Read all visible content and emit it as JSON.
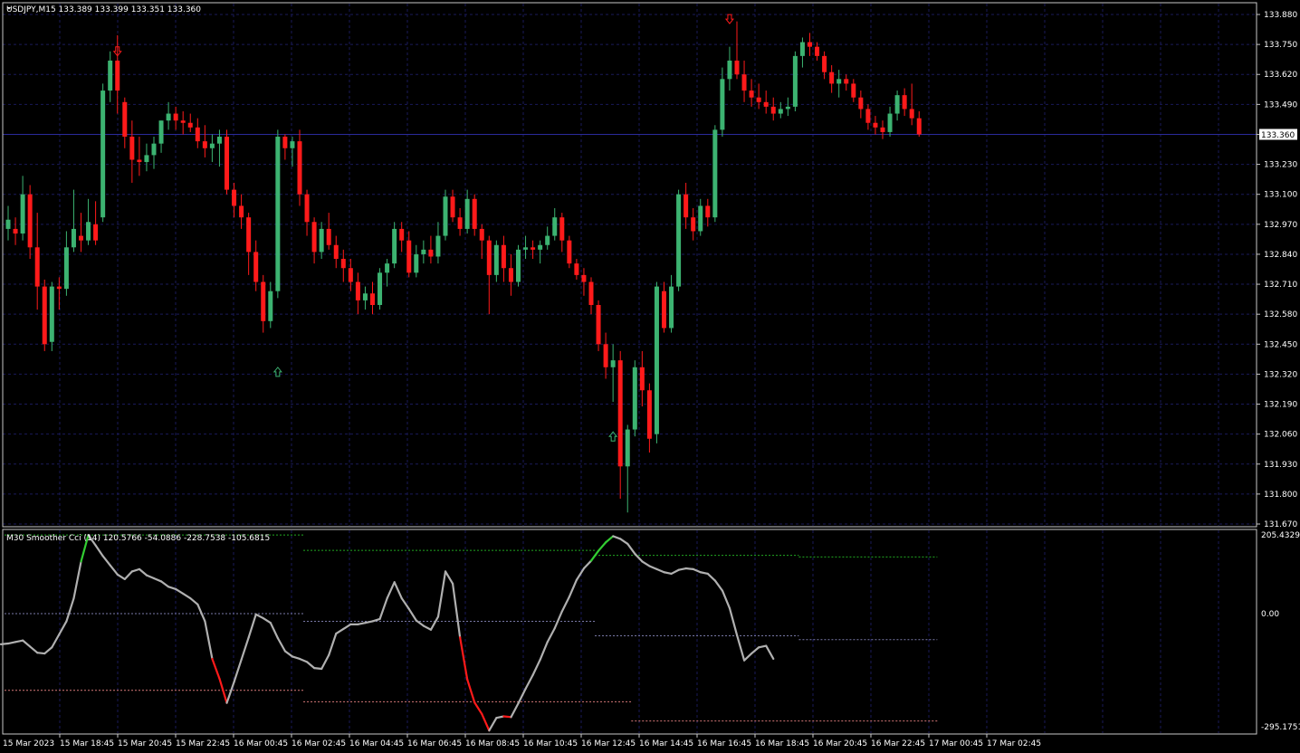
{
  "window": {
    "symbol_header": "USDJPY,M15  133.389 133.399 133.351 133.360"
  },
  "price_axis": {
    "ticks": [
      "133.880",
      "133.750",
      "133.620",
      "133.490",
      "133.360",
      "133.230",
      "133.100",
      "132.970",
      "132.840",
      "132.710",
      "132.580",
      "132.450",
      "132.320",
      "132.190",
      "132.060",
      "131.930",
      "131.800",
      "131.670"
    ],
    "current_price": "133.360"
  },
  "indicator": {
    "header": "M30 Smoother Cci (14) 120.5766 -54.0886 -228.7538 -105.6815",
    "ticks": [
      "205.4329",
      "0.00",
      "-295.1751"
    ]
  },
  "time_axis": {
    "labels": [
      "15 Mar 2023",
      "15 Mar 18:45",
      "15 Mar 20:45",
      "15 Mar 22:45",
      "16 Mar 00:45",
      "16 Mar 02:45",
      "16 Mar 04:45",
      "16 Mar 06:45",
      "16 Mar 08:45",
      "16 Mar 10:45",
      "16 Mar 12:45",
      "16 Mar 14:45",
      "16 Mar 16:45",
      "16 Mar 18:45",
      "16 Mar 20:45",
      "16 Mar 22:45",
      "17 Mar 00:45",
      "17 Mar 02:45"
    ]
  },
  "colors": {
    "bull": "#3cb371",
    "bear": "#ff1a1a",
    "grid": "#1a1a5a",
    "cci": "#b0b0b0",
    "cci_up": "#32cd32",
    "cci_down": "#ff1a1a"
  },
  "chart_data": [
    {
      "type": "candlestick",
      "title": "USDJPY,M15",
      "ylim": [
        131.67,
        133.88
      ],
      "candles": [
        [
          132.95,
          133.05,
          132.9,
          132.99
        ],
        [
          132.95,
          133.0,
          132.88,
          132.93
        ],
        [
          132.93,
          133.18,
          132.9,
          133.1
        ],
        [
          133.1,
          133.14,
          132.82,
          132.87
        ],
        [
          132.87,
          133.02,
          132.6,
          132.7
        ],
        [
          132.7,
          132.73,
          132.42,
          132.45
        ],
        [
          132.46,
          132.72,
          132.42,
          132.7
        ],
        [
          132.7,
          132.74,
          132.6,
          132.69
        ],
        [
          132.69,
          132.94,
          132.66,
          132.87
        ],
        [
          132.87,
          133.12,
          132.85,
          132.95
        ],
        [
          132.92,
          133.02,
          132.85,
          132.9
        ],
        [
          132.9,
          133.08,
          132.88,
          132.98
        ],
        [
          132.97,
          133.07,
          132.88,
          132.9
        ],
        [
          133.0,
          133.58,
          132.98,
          133.55
        ],
        [
          133.55,
          133.72,
          133.5,
          133.68
        ],
        [
          133.68,
          133.79,
          133.45,
          133.55
        ],
        [
          133.5,
          133.52,
          133.3,
          133.35
        ],
        [
          133.35,
          133.42,
          133.15,
          133.25
        ],
        [
          133.25,
          133.35,
          133.18,
          133.24
        ],
        [
          133.24,
          133.32,
          133.2,
          133.27
        ],
        [
          133.27,
          133.35,
          133.21,
          133.32
        ],
        [
          133.32,
          133.42,
          133.28,
          133.42
        ],
        [
          133.42,
          133.5,
          133.38,
          133.45
        ],
        [
          133.45,
          133.48,
          133.38,
          133.42
        ],
        [
          133.42,
          133.46,
          133.36,
          133.41
        ],
        [
          133.41,
          133.45,
          133.37,
          133.39
        ],
        [
          133.39,
          133.43,
          133.3,
          133.33
        ],
        [
          133.33,
          133.4,
          133.26,
          133.3
        ],
        [
          133.3,
          133.36,
          133.24,
          133.32
        ],
        [
          133.32,
          133.38,
          133.22,
          133.35
        ],
        [
          133.35,
          133.38,
          133.1,
          133.12
        ],
        [
          133.12,
          133.15,
          133.0,
          133.05
        ],
        [
          133.05,
          133.1,
          132.95,
          133.0
        ],
        [
          133.0,
          133.02,
          132.75,
          132.85
        ],
        [
          132.85,
          132.9,
          132.68,
          132.72
        ],
        [
          132.72,
          132.75,
          132.5,
          132.55
        ],
        [
          132.55,
          132.72,
          132.52,
          132.68
        ],
        [
          132.68,
          133.38,
          132.65,
          133.35
        ],
        [
          133.35,
          133.36,
          133.25,
          133.3
        ],
        [
          133.3,
          133.35,
          133.22,
          133.33
        ],
        [
          133.33,
          133.38,
          133.05,
          133.1
        ],
        [
          133.1,
          133.12,
          132.92,
          132.98
        ],
        [
          132.98,
          133.0,
          132.8,
          132.85
        ],
        [
          132.85,
          132.98,
          132.82,
          132.95
        ],
        [
          132.95,
          133.02,
          132.86,
          132.88
        ],
        [
          132.88,
          132.92,
          132.78,
          132.82
        ],
        [
          132.82,
          132.86,
          132.72,
          132.78
        ],
        [
          132.78,
          132.82,
          132.68,
          132.72
        ],
        [
          132.72,
          132.76,
          132.58,
          132.64
        ],
        [
          132.64,
          132.7,
          132.6,
          132.67
        ],
        [
          132.67,
          132.72,
          132.58,
          132.62
        ],
        [
          132.62,
          132.78,
          132.6,
          132.76
        ],
        [
          132.76,
          132.82,
          132.7,
          132.8
        ],
        [
          132.8,
          132.98,
          132.78,
          132.95
        ],
        [
          132.95,
          132.98,
          132.85,
          132.9
        ],
        [
          132.9,
          132.94,
          132.74,
          132.76
        ],
        [
          132.76,
          132.88,
          132.74,
          132.84
        ],
        [
          132.84,
          132.9,
          132.8,
          132.86
        ],
        [
          132.86,
          132.92,
          132.8,
          132.83
        ],
        [
          132.83,
          132.98,
          132.8,
          132.92
        ],
        [
          132.92,
          133.12,
          132.9,
          133.09
        ],
        [
          133.09,
          133.12,
          132.98,
          133.0
        ],
        [
          133.0,
          133.04,
          132.92,
          132.95
        ],
        [
          132.95,
          133.12,
          132.93,
          133.08
        ],
        [
          133.08,
          133.1,
          132.92,
          132.95
        ],
        [
          132.95,
          132.97,
          132.82,
          132.9
        ],
        [
          132.9,
          132.92,
          132.58,
          132.75
        ],
        [
          132.75,
          132.9,
          132.72,
          132.88
        ],
        [
          132.88,
          132.92,
          132.72,
          132.78
        ],
        [
          132.78,
          132.84,
          132.66,
          132.72
        ],
        [
          132.72,
          132.88,
          132.7,
          132.86
        ],
        [
          132.86,
          132.92,
          132.82,
          132.87
        ],
        [
          132.87,
          132.9,
          132.82,
          132.86
        ],
        [
          132.86,
          132.9,
          132.8,
          132.88
        ],
        [
          132.88,
          132.96,
          132.86,
          132.92
        ],
        [
          132.92,
          133.04,
          132.9,
          133.0
        ],
        [
          133.0,
          133.02,
          132.85,
          132.9
        ],
        [
          132.9,
          132.92,
          132.78,
          132.8
        ],
        [
          132.8,
          132.82,
          132.73,
          132.75
        ],
        [
          132.75,
          132.78,
          132.66,
          132.72
        ],
        [
          132.72,
          132.74,
          132.58,
          132.62
        ],
        [
          132.62,
          132.64,
          132.42,
          132.45
        ],
        [
          132.45,
          132.5,
          132.3,
          132.35
        ],
        [
          132.35,
          132.45,
          132.2,
          132.38
        ],
        [
          132.38,
          132.42,
          131.78,
          131.92
        ],
        [
          131.92,
          132.1,
          131.72,
          132.08
        ],
        [
          132.08,
          132.38,
          132.05,
          132.35
        ],
        [
          132.35,
          132.42,
          132.18,
          132.25
        ],
        [
          132.25,
          132.28,
          131.98,
          132.04
        ],
        [
          132.06,
          132.72,
          132.02,
          132.7
        ],
        [
          132.68,
          132.72,
          132.5,
          132.52
        ],
        [
          132.52,
          132.75,
          132.5,
          132.7
        ],
        [
          132.7,
          133.12,
          132.68,
          133.1
        ],
        [
          133.1,
          133.15,
          132.95,
          133.0
        ],
        [
          133.0,
          133.04,
          132.9,
          132.94
        ],
        [
          132.94,
          133.08,
          132.92,
          133.05
        ],
        [
          133.05,
          133.08,
          132.96,
          133.0
        ],
        [
          133.0,
          133.4,
          132.98,
          133.38
        ],
        [
          133.38,
          133.65,
          133.35,
          133.6
        ],
        [
          133.6,
          133.74,
          133.55,
          133.68
        ],
        [
          133.68,
          133.85,
          133.6,
          133.62
        ],
        [
          133.62,
          133.68,
          133.5,
          133.55
        ],
        [
          133.55,
          133.6,
          133.48,
          133.52
        ],
        [
          133.52,
          133.58,
          133.47,
          133.5
        ],
        [
          133.5,
          133.55,
          133.45,
          133.48
        ],
        [
          133.48,
          133.52,
          133.42,
          133.45
        ],
        [
          133.45,
          133.5,
          133.43,
          133.47
        ],
        [
          133.47,
          133.52,
          133.44,
          133.48
        ],
        [
          133.48,
          133.72,
          133.46,
          133.7
        ],
        [
          133.7,
          133.78,
          133.65,
          133.76
        ],
        [
          133.76,
          133.8,
          133.7,
          133.74
        ],
        [
          133.74,
          133.76,
          133.68,
          133.7
        ],
        [
          133.7,
          133.72,
          133.6,
          133.63
        ],
        [
          133.63,
          133.66,
          133.54,
          133.58
        ],
        [
          133.58,
          133.64,
          133.52,
          133.6
        ],
        [
          133.6,
          133.62,
          133.55,
          133.58
        ],
        [
          133.58,
          133.6,
          133.5,
          133.52
        ],
        [
          133.52,
          133.55,
          133.43,
          133.47
        ],
        [
          133.47,
          133.49,
          133.38,
          133.41
        ],
        [
          133.41,
          133.44,
          133.36,
          133.39
        ],
        [
          133.39,
          133.42,
          133.34,
          133.37
        ],
        [
          133.37,
          133.48,
          133.35,
          133.45
        ],
        [
          133.45,
          133.55,
          133.42,
          133.53
        ],
        [
          133.53,
          133.56,
          133.44,
          133.47
        ],
        [
          133.47,
          133.58,
          133.4,
          133.43
        ],
        [
          133.43,
          133.46,
          133.35,
          133.36
        ]
      ],
      "signals": [
        {
          "dir": "down",
          "index": 15,
          "price": 133.72
        },
        {
          "dir": "up",
          "index": 37,
          "price": 132.33
        },
        {
          "dir": "up",
          "index": 83,
          "price": 132.05
        },
        {
          "dir": "down",
          "index": 99,
          "price": 133.86
        }
      ]
    },
    {
      "type": "line",
      "title": "M30 Smoother Cci (14)",
      "ylim": [
        -295.1751,
        205.4329
      ],
      "levels": [
        {
          "from": 0,
          "to": 40,
          "value": 205
        },
        {
          "from": 41,
          "to": 80,
          "value": 165
        },
        {
          "from": 81,
          "to": 108,
          "value": 152
        },
        {
          "from": 109,
          "to": 127,
          "value": 148
        },
        {
          "from": 0,
          "to": 40,
          "value": 0
        },
        {
          "from": 41,
          "to": 80,
          "value": -20
        },
        {
          "from": 81,
          "to": 108,
          "value": -58
        },
        {
          "from": 109,
          "to": 127,
          "value": -68
        },
        {
          "from": 0,
          "to": 40,
          "value": -200
        },
        {
          "from": 41,
          "to": 85,
          "value": -230
        },
        {
          "from": 86,
          "to": 127,
          "value": -280
        }
      ],
      "values": [
        -80,
        -78,
        -74,
        -70,
        -86,
        -102,
        -104,
        -88,
        -54,
        -20,
        40,
        136,
        205,
        178,
        150,
        126,
        102,
        90,
        110,
        116,
        100,
        92,
        84,
        70,
        64,
        52,
        40,
        24,
        -20,
        -118,
        -170,
        -233,
        -178,
        -120,
        -62,
        -2,
        -12,
        -24,
        -64,
        -98,
        -112,
        -118,
        -126,
        -142,
        -144,
        -108,
        -52,
        -40,
        -28,
        -28,
        -24,
        -20,
        -14,
        40,
        82,
        40,
        12,
        -18,
        -32,
        -42,
        -8,
        110,
        78,
        -62,
        -172,
        -232,
        -262,
        -305,
        -272,
        -268,
        -270,
        -234,
        -196,
        -160,
        -120,
        -74,
        -38,
        6,
        44,
        88,
        118,
        138,
        164,
        186,
        202,
        195,
        182,
        156,
        136,
        124,
        116,
        108,
        104,
        114,
        118,
        116,
        108,
        104,
        86,
        60,
        14,
        -56,
        -122,
        -104,
        -88,
        -84,
        -118
      ]
    }
  ]
}
